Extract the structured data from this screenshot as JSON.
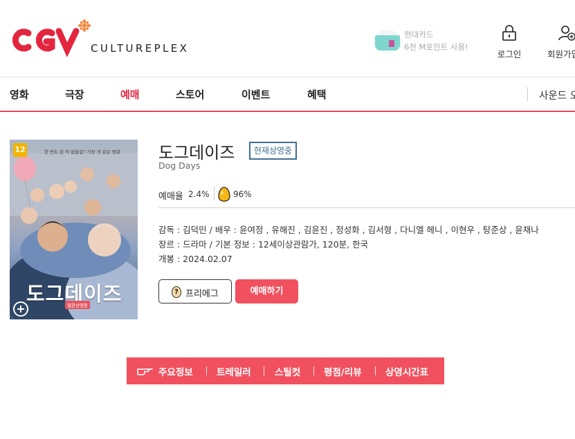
{
  "brand": {
    "logo_text": "CGV",
    "tagline": "CULTUREPLEX",
    "colors": {
      "red": "#e3253e",
      "orange": "#f4863b",
      "accent": "#f1515f",
      "status_blue": "#3d6e93"
    }
  },
  "promo": {
    "line1": "현대카드",
    "line2": "6천 M포인트 사용!",
    "icon": "credit-card-icon"
  },
  "header_actions": [
    {
      "label": "로그인",
      "icon": "lock-icon"
    },
    {
      "label": "회원가입",
      "icon": "add-user-icon"
    }
  ],
  "nav": {
    "items": [
      {
        "label": "영화",
        "active": false
      },
      {
        "label": "극장",
        "active": false
      },
      {
        "label": "예매",
        "active": true
      },
      {
        "label": "스토어",
        "active": false
      },
      {
        "label": "이벤트",
        "active": false
      },
      {
        "label": "혜택",
        "active": false
      }
    ],
    "right_label": "사운드 오"
  },
  "movie": {
    "title": "도그데이즈",
    "status": "현재상영중",
    "english_title": "Dog Days",
    "booking_rate_label": "예매율",
    "booking_rate": "2.4%",
    "egg_rate": "96%",
    "director_cast": "감독 : 김덕민 / 배우 : 윤여정 ,  유해진 ,  김윤진 ,  정성화 ,  김서형 ,  다니엘 헤니 ,  이현우 ,  탕준상 ,  윤채나",
    "genre_info": "장르 : 드라마 / 기본 정보 : 12세이상관람가, 120분, 한국",
    "release": "개봉 : 2024.02.07",
    "poster": {
      "age_rating": "12",
      "tagline": "한 번도 본 적 없을걸? 가장 개 같은 영화",
      "title": "도그데이즈",
      "badge": "절찬상영중"
    }
  },
  "buttons": {
    "pre_egg": "프리에그",
    "book": "예매하기"
  },
  "tabs": [
    "주요정보",
    "트레일러",
    "스틸컷",
    "평점/리뷰",
    "상영시간표"
  ]
}
